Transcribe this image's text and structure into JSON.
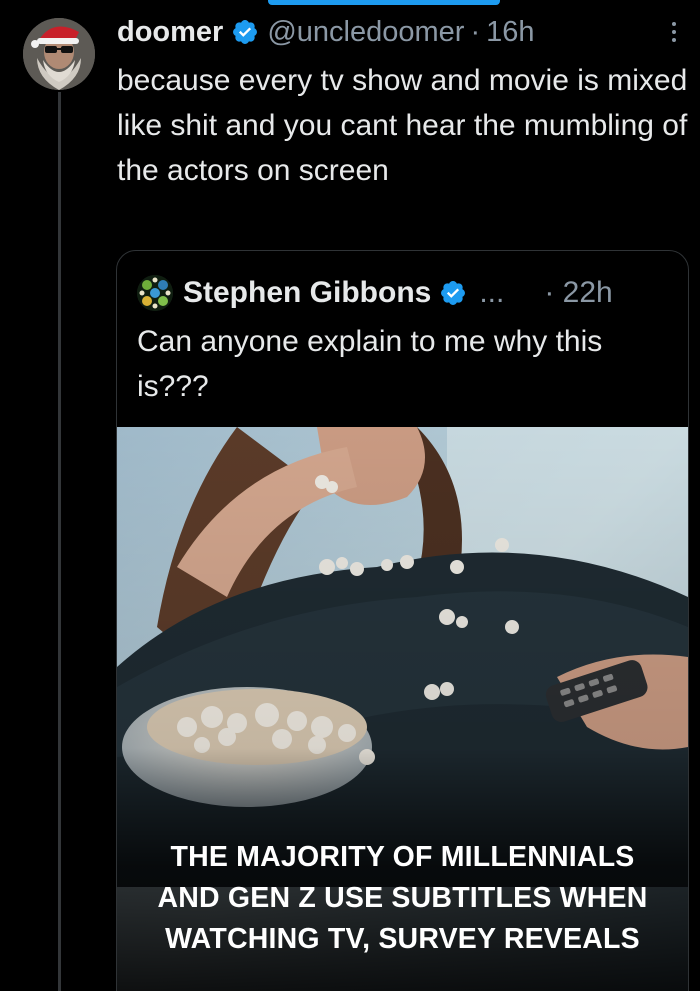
{
  "post": {
    "display_name": "doomer",
    "handle": "@uncledoomer",
    "separator": "·",
    "time": "16h",
    "text": "because every tv show and movie is mixed like shit and you cant hear the mumbling of the actors on screen"
  },
  "quote": {
    "display_name": "Stephen Gibbons",
    "ellipsis": "...",
    "time": "· 22h",
    "text": "Can anyone explain to me why this is???",
    "media_caption": [
      "THE MAJORITY OF MILLENNIALS",
      "AND GEN Z USE SUBTITLES WHEN",
      "WATCHING TV, SURVEY REVEALS"
    ]
  },
  "colors": {
    "background": "#000000",
    "text": "#e7e9ea",
    "muted": "#8b98a5",
    "verified": "#1d9bf0",
    "border": "#2f3336"
  },
  "icons": {
    "verified": "verified-badge-icon",
    "more": "more-vertical-icon"
  }
}
